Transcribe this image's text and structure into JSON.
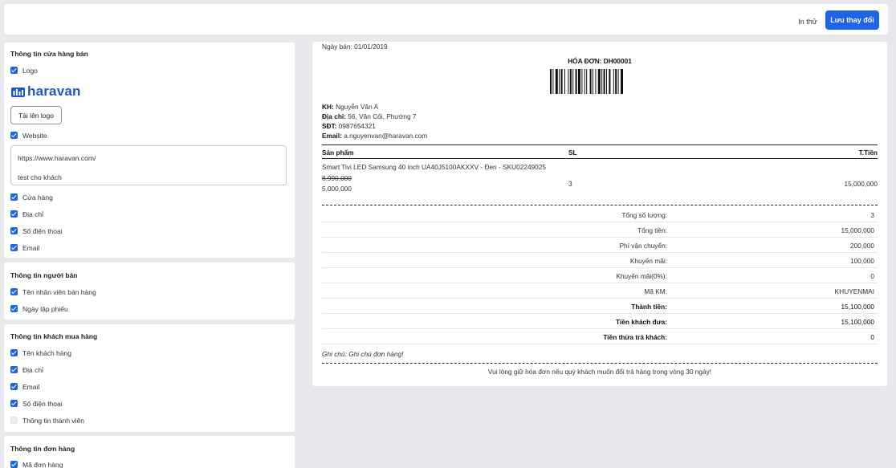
{
  "toolbar": {
    "print_label": "In thử",
    "save_label": "Lưu thay đổi"
  },
  "store_info": {
    "title": "Thông tin cửa hàng bán",
    "logo_label": "Logo",
    "logo_brand": "haravan",
    "upload_label": "Tải lên logo",
    "website_label": "Website",
    "website_text": [
      "https://www.haravan.com/",
      "",
      "test cho khách"
    ],
    "items": [
      "Cửa hàng",
      "Địa chỉ",
      "Số điện thoại",
      "Email"
    ]
  },
  "seller_info": {
    "title": "Thông tin người bán",
    "items": [
      "Tên nhân viên bán hàng",
      "Ngày lập phiếu"
    ]
  },
  "customer_info": {
    "title": "Thông tin khách mua hàng",
    "items": [
      "Tên khách hàng",
      "Địa chỉ",
      "Email",
      "Số điện thoại",
      "Thông tin thành viên"
    ],
    "checked": [
      true,
      true,
      true,
      true,
      false
    ]
  },
  "order_info": {
    "title": "Thông tin đơn hàng",
    "items": [
      "Mã đơn hàng"
    ]
  },
  "receipt": {
    "date_line": "Ngày bán: 01/01/2019",
    "invoice_title": "HÓA ĐƠN: DH00001",
    "customer": {
      "name_label": "KH:",
      "name": "Nguyễn Văn A",
      "address_label": "Địa chỉ:",
      "address": "56, Văn Cối, Phường 7",
      "phone_label": "SĐT:",
      "phone": "0987654321",
      "email_label": "Email:",
      "email": "a.nguyenvan@haravan.com"
    },
    "columns": {
      "product": "Sản phẩm",
      "qty": "SL",
      "total": "T.Tiền"
    },
    "line_item": {
      "name": "Smart Tivi LED Samsung 40 inch UA40J5100AKXXV - Đen - SKU02249025",
      "old_price": "8,990,000",
      "price": "5,000,000",
      "qty": "3",
      "total": "15,000,000"
    },
    "summary": [
      {
        "label": "Tổng số lượng:",
        "value": "3",
        "strong": false
      },
      {
        "label": "Tổng tiền:",
        "value": "15,000,000",
        "strong": false
      },
      {
        "label": "Phí vận chuyển:",
        "value": "200,000",
        "strong": false
      },
      {
        "label": "Khuyến mãi:",
        "value": "100,000",
        "strong": false
      },
      {
        "label": "Khuyến mãi(0%):",
        "value": "0",
        "strong": false
      },
      {
        "label": "Mã KM:",
        "value": "KHUYENMAI",
        "strong": false
      },
      {
        "label": "Thành tiền:",
        "value": "15,100,000",
        "strong": true
      },
      {
        "label": "Tiền khách đưa:",
        "value": "15,100,000",
        "strong": true
      },
      {
        "label": "Tiền thừa trả khách:",
        "value": "0",
        "strong": true
      }
    ],
    "note": "Ghi chú: Ghi chú đơn hàng!",
    "footer": "Vui lòng giữ hóa đơn nếu quý khách muốn đổi trả hàng trong vòng 30 ngày!"
  },
  "colors": {
    "accent": "#1f63e6",
    "background": "#e8e9ec",
    "logo": "#1d57c6"
  },
  "icons": {
    "checkbox": "checkbox-checked-icon",
    "logo": "haravan-logo-icon",
    "barcode": "barcode-icon"
  }
}
